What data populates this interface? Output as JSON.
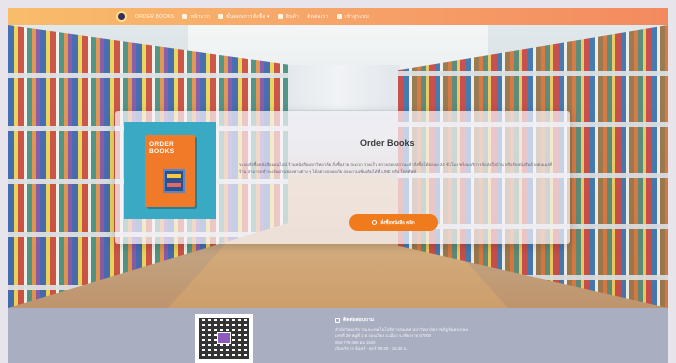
{
  "nav": {
    "items": [
      {
        "label": "ORDER BOOKS",
        "icon": "logo-icon"
      },
      {
        "label": "หน้าแรก",
        "icon": "home-icon"
      },
      {
        "label": "ขั้นตอนการสั่งซื้อ ▾",
        "icon": "list-icon"
      },
      {
        "label": "สินค้า",
        "icon": "book-icon"
      },
      {
        "label": "ติดต่อเรา",
        "icon": "phone-icon"
      },
      {
        "label": "เข้าสู่ระบบ",
        "icon": "user-icon"
      }
    ]
  },
  "card": {
    "cover_title": "ORDER BOOKS",
    "title": "Order Books",
    "description": "ระบบสั่งซื้อหนังสือออนไลน์ ร้านหนังสือมหาวิทยาลัย สั่งซื้อง่าย สะดวก รวดเร็ว ตรวจสอบสถานะคำสั่งซื้อได้ตลอด 24 ชั่วโมง พร้อมบริการจัดส่งถึงบ้าน หรือรับหนังสือด้วยตนเองที่ร้าน สามารถชำระเงินผ่านช่องทางต่าง ๆ ได้อย่างปลอดภัย สอบถามเพิ่มเติมได้ที่ LINE หรือ โทรศัพท์",
    "button_label": "สั่งซื้อหนังสือ คลิก"
  },
  "footer": {
    "contact_title": "ติดต่อสอบถาม",
    "lines": [
      "สำนักวิทยบริการและเทคโนโลยีสารสนเทศ มหาวิทยาลัยราชภัฏจันทรเกษม",
      "เลขที่ 39 หมู่ที่ 1 ต.รอบเวียง อ.เมือง จ.เชียงราย 57000",
      "053-776 058 ต่อ 1520",
      "เปิดบริการ จันทร์ - ศุกร์ 08:30 - 16:30 น."
    ]
  },
  "colors": {
    "nav_gradient_start": "#f8bd6a",
    "nav_gradient_end": "#f38a5f",
    "button": "#f07b1c",
    "footer": "#a9aec0",
    "cover_bg": "#3aa9c4"
  }
}
